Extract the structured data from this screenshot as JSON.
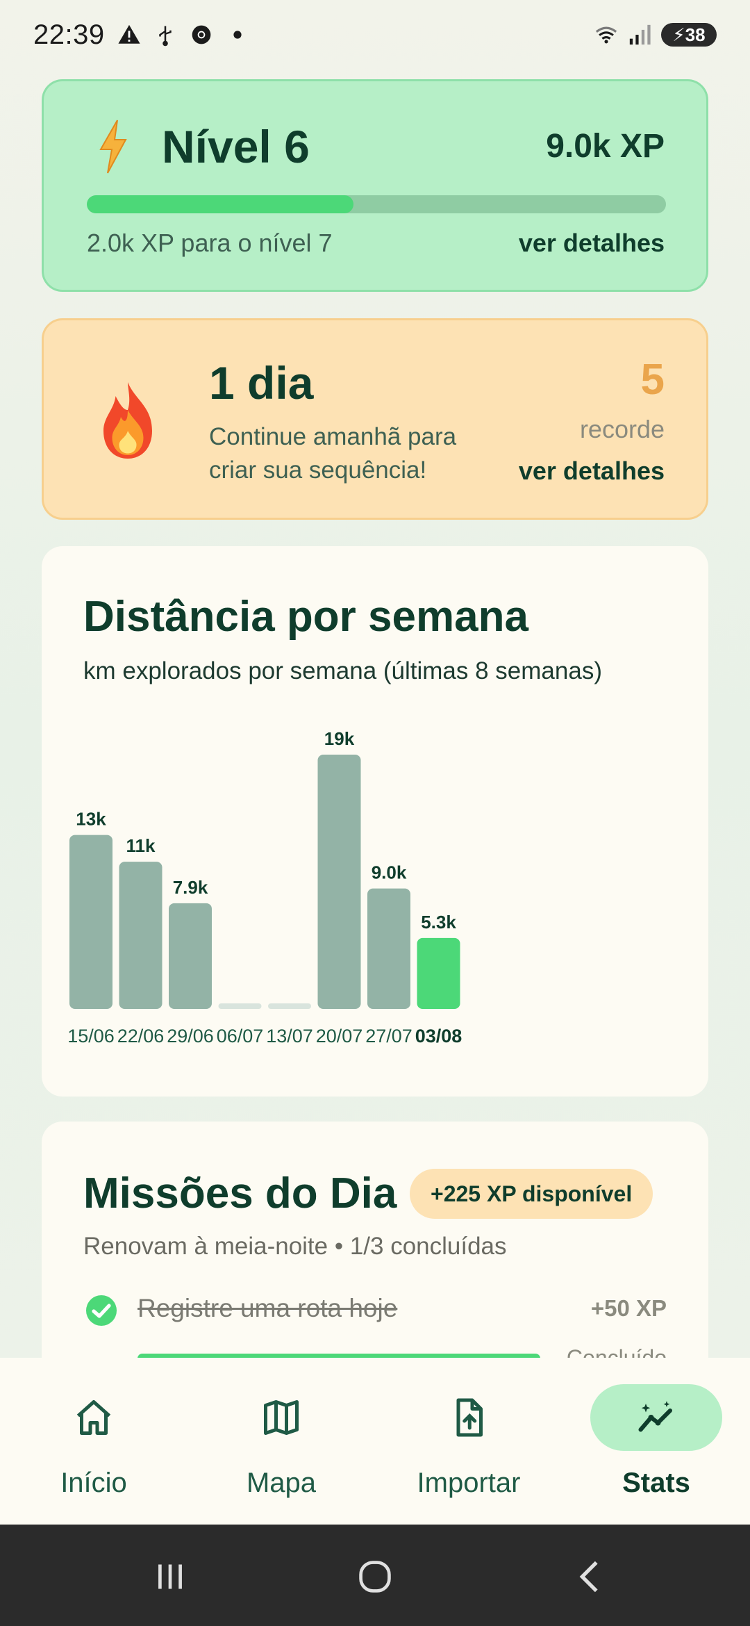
{
  "status_bar": {
    "time": "22:39",
    "battery": "38",
    "icons": [
      "warning-icon",
      "usb-icon",
      "chrome-icon",
      "dot-icon",
      "wifi-icon",
      "signal-icon"
    ]
  },
  "level": {
    "title": "Nível 6",
    "xp_total": "9.0k XP",
    "progress_fraction": 0.46,
    "next_text": "2.0k XP para o nível 7",
    "details_link": "ver detalhes"
  },
  "streak": {
    "days": "1 dia",
    "message": "Continue amanhã para criar sua sequência!",
    "record_value": "5",
    "record_label": "recorde",
    "details_link": "ver detalhes"
  },
  "chart": {
    "title": "Distância por semana",
    "subtitle": "km explorados por semana (últimas 8 semanas)"
  },
  "chart_data": {
    "type": "bar",
    "title": "Distância por semana",
    "subtitle": "km explorados por semana (últimas 8 semanas)",
    "categories": [
      "15/06",
      "22/06",
      "29/06",
      "06/07",
      "13/07",
      "20/07",
      "27/07",
      "03/08"
    ],
    "values": [
      13000,
      11000,
      7900,
      0,
      0,
      19000,
      9000,
      5300
    ],
    "data_labels": [
      "13k",
      "11k",
      "7.9k",
      "",
      "",
      "19k",
      "9.0k",
      "5.3k"
    ],
    "highlight_index": 7,
    "colors": {
      "bar": "#93b3a6",
      "highlight": "#4cd878",
      "empty": "#d9e4dd"
    },
    "ylim": [
      0,
      19000
    ],
    "grid": false
  },
  "missions": {
    "title": "Missões do Dia",
    "badge": "+225 XP disponível",
    "subtitle": "Renovam à meia-noite • 1/3 concluídas",
    "items": [
      {
        "text": "Registre uma rota hoje",
        "xp": "+50 XP",
        "status": "Concluído",
        "done": true
      }
    ]
  },
  "nav": {
    "items": [
      {
        "label": "Início",
        "icon": "home-icon"
      },
      {
        "label": "Mapa",
        "icon": "map-icon"
      },
      {
        "label": "Importar",
        "icon": "import-file-icon"
      },
      {
        "label": "Stats",
        "icon": "stats-icon",
        "active": true
      }
    ]
  },
  "theme": {
    "accent": "#4cd878",
    "dark_green": "#0f3d2c",
    "orange": "#eaa54c"
  }
}
